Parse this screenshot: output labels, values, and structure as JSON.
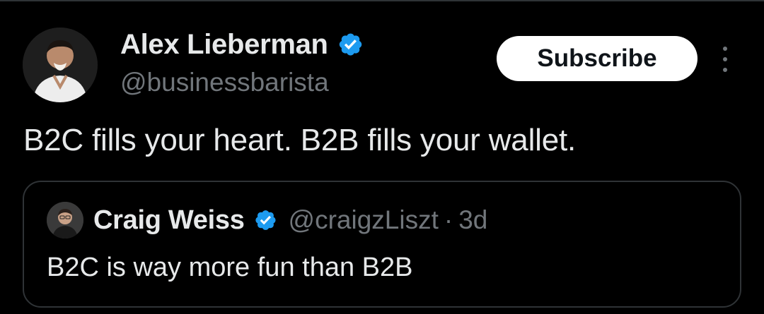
{
  "author": {
    "name": "Alex Lieberman",
    "handle": "@businessbarista",
    "verified": true,
    "avatar_icon": "profile-photo"
  },
  "actions": {
    "subscribe_label": "Subscribe",
    "more_icon": "more-vertical-icon"
  },
  "tweet": {
    "text": "B2C fills your heart. B2B fills your wallet."
  },
  "quote": {
    "author_name": "Craig Weiss",
    "author_handle": "@craigzLiszt",
    "separator": "·",
    "time": "3d",
    "verified": true,
    "text": "B2C is way more fun than B2B"
  },
  "colors": {
    "background": "#000000",
    "text_primary": "#e7e9ea",
    "text_secondary": "#71767b",
    "verified_blue": "#1d9bf0",
    "border": "#2f3336",
    "button_bg": "#ffffff"
  }
}
